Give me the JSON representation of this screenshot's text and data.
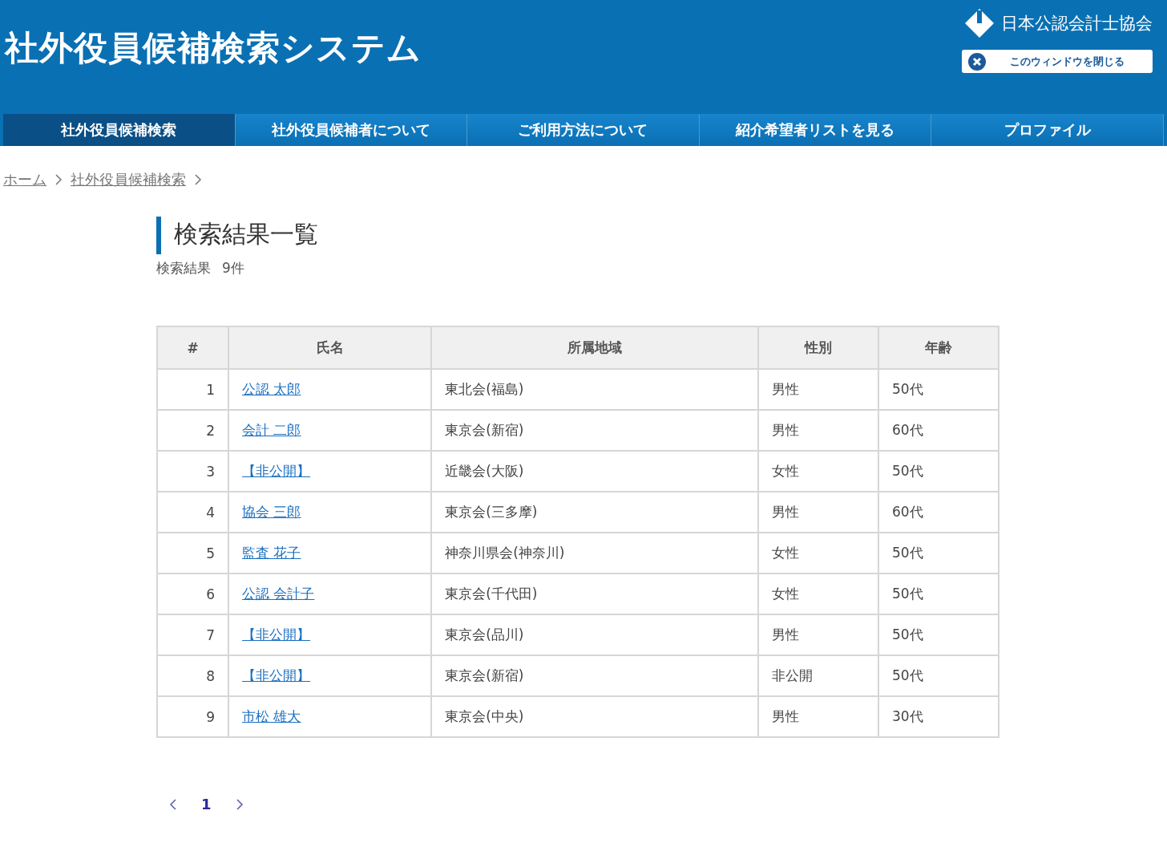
{
  "header": {
    "title": "社外役員候補検索システム",
    "org_name": "日本公認会計士協会",
    "close_button": "このウィンドウを閉じる"
  },
  "nav": [
    {
      "label": "社外役員候補検索",
      "selected": true
    },
    {
      "label": "社外役員候補者について",
      "selected": false
    },
    {
      "label": "ご利用方法について",
      "selected": false
    },
    {
      "label": "紹介希望者リストを見る",
      "selected": false
    },
    {
      "label": "プロファイル",
      "selected": false
    }
  ],
  "breadcrumb": [
    "ホーム",
    "社外役員候補検索"
  ],
  "heading": "検索結果一覧",
  "result_count": {
    "label": "検索結果",
    "value": "9件"
  },
  "table": {
    "columns": [
      "#",
      "氏名",
      "所属地域",
      "性別",
      "年齢"
    ],
    "rows": [
      [
        "1",
        "公認 太郎",
        "東北会(福島)",
        "男性",
        "50代"
      ],
      [
        "2",
        "会計 二郎",
        "東京会(新宿)",
        "男性",
        "60代"
      ],
      [
        "3",
        "【非公開】",
        "近畿会(大阪)",
        "女性",
        "50代"
      ],
      [
        "4",
        "協会 三郎",
        "東京会(三多摩)",
        "男性",
        "60代"
      ],
      [
        "5",
        "監査 花子",
        "神奈川県会(神奈川)",
        "女性",
        "50代"
      ],
      [
        "6",
        "公認 会計子",
        "東京会(千代田)",
        "女性",
        "50代"
      ],
      [
        "7",
        "【非公開】",
        "東京会(品川)",
        "男性",
        "50代"
      ],
      [
        "8",
        "【非公開】",
        "東京会(新宿)",
        "非公開",
        "50代"
      ],
      [
        "9",
        "市松 雄大",
        "東京会(中央)",
        "男性",
        "30代"
      ]
    ]
  },
  "pagination": {
    "pages": [
      "1"
    ]
  }
}
